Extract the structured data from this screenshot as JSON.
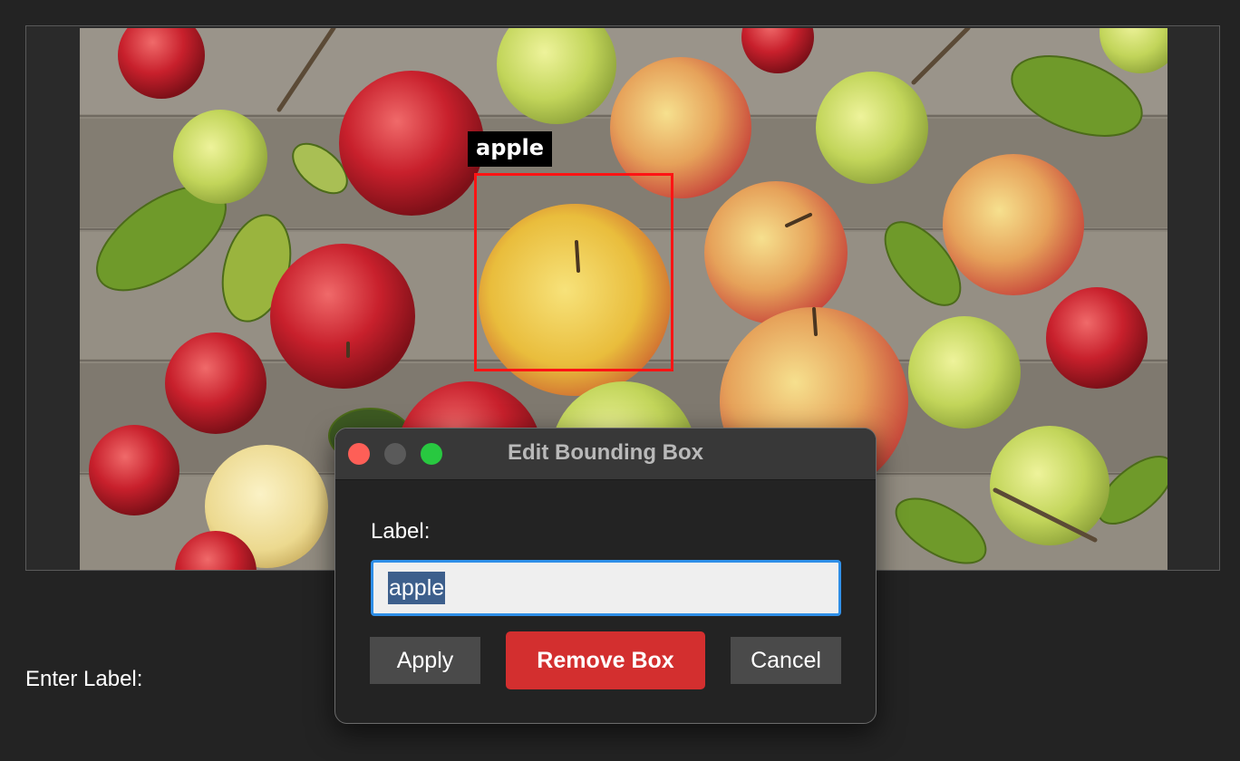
{
  "canvas": {
    "annotations": [
      {
        "label": "apple",
        "color": "#ff1414"
      }
    ]
  },
  "bottom_panel": {
    "enter_label_text": "Enter Label:"
  },
  "dialog": {
    "title": "Edit Bounding Box",
    "field_label": "Label:",
    "label_value": "apple",
    "buttons": {
      "apply": "Apply",
      "remove": "Remove Box",
      "cancel": "Cancel"
    },
    "colors": {
      "remove_button": "#d32f2f",
      "input_focus_ring": "#2f8fe8",
      "close_light": "#fe5f57",
      "zoom_light": "#28c840"
    }
  }
}
